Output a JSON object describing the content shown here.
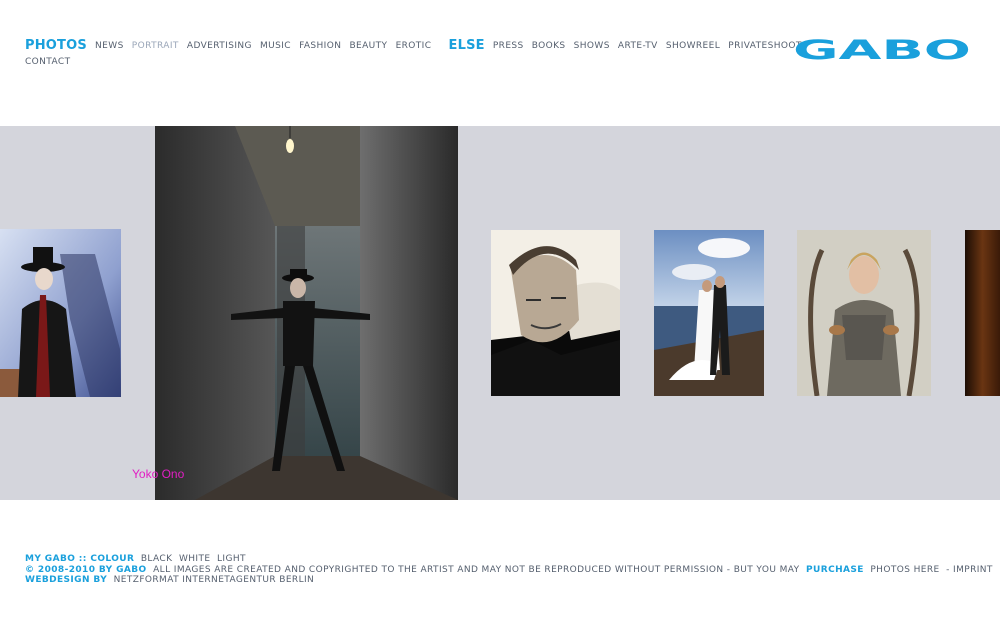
{
  "nav": {
    "photos_label": "PHOTOS",
    "photos_items": [
      {
        "label": "NEWS"
      },
      {
        "label": "PORTRAIT"
      },
      {
        "label": "ADVERTISING"
      },
      {
        "label": "MUSIC"
      },
      {
        "label": "FASHION"
      },
      {
        "label": "BEAUTY"
      },
      {
        "label": "EROTIC"
      }
    ],
    "else_label": "ELSE",
    "else_items": [
      {
        "label": "PRESS"
      },
      {
        "label": "BOOKS"
      },
      {
        "label": "SHOWS"
      },
      {
        "label": "ARTE-TV"
      },
      {
        "label": "SHOWREEL"
      },
      {
        "label": "PRIVATESHOOTS"
      },
      {
        "label": "CONTACT"
      }
    ]
  },
  "logo": {
    "text": "GABO",
    "color": "#1aa0dc"
  },
  "gallery": {
    "caption": "Yoko Ono",
    "caption_color": "#e21ec4",
    "background": "#d4d5dc"
  },
  "footer": {
    "my_gabo": "MY GABO :: COLOUR",
    "colour_options": [
      "BLACK",
      "WHITE",
      "LIGHT"
    ],
    "copyright_prefix": "© 2008-2010 BY GABO",
    "copyright_text": "ALL IMAGES ARE CREATED AND COPYRIGHTED TO THE ARTIST AND MAY NOT BE REPRODUCED WITHOUT PERMISSION - BUT YOU MAY",
    "purchase": "PURCHASE",
    "photos_here": "PHOTOS HERE",
    "imprint": "- IMPRINT",
    "webdesign_label": "WEBDESIGN BY",
    "webdesign_name": "NETZFORMAT INTERNETAGENTUR BERLIN"
  }
}
